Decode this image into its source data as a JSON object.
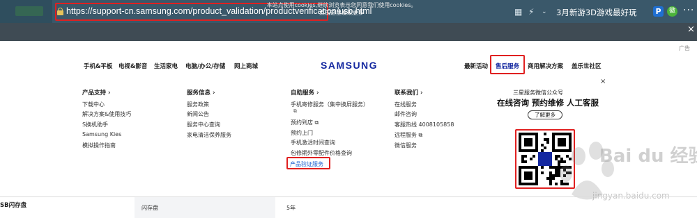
{
  "browser": {
    "url": "https://support-cn.samsung.com/product_validation/productverification/usb.html",
    "promo": "3月新游3D游戏最好玩",
    "avatar_p": "P",
    "avatar_g": "徽",
    "menu_dots": "···",
    "icons": [
      "grid-icon",
      "lightning-icon",
      "chevron-down-icon",
      "search-icon"
    ]
  },
  "cookie": {
    "text": "本站点使用cookies,继续浏览表示您同意我们使用cookies。",
    "link": "点击这里发现更多",
    "close": "×"
  },
  "ad_label": "广告",
  "nav": {
    "left": [
      "手机&平板",
      "电视&影音",
      "生活家电",
      "电脑/办公/存储",
      "网上商城"
    ],
    "logo": "SAMSUNG",
    "right": [
      "最新活动",
      "售后服务",
      "商用解决方案",
      "盖乐世社区"
    ],
    "active": "售后服务"
  },
  "columns": [
    {
      "head": "产品支持 ›",
      "items": [
        "下载中心",
        "解决方案&使用技巧",
        "S换机助手",
        "Samsung Kies",
        "模拟操作指南"
      ]
    },
    {
      "head": "服务信息 ›",
      "items": [
        "服务政策",
        "新闻公告",
        "服务中心查询",
        "家电清洁保养服务"
      ]
    },
    {
      "head": "自助服务 ›",
      "items": [
        "手机寄修服务（集中换屏服务）",
        "⧉",
        "预约到店 ⧉",
        "预约上门",
        "手机激活时间查询",
        "包修期外零配件价格查询",
        "产品验证服务"
      ]
    },
    {
      "head": "联系我们 ›",
      "items": [
        "在线服务",
        "邮件咨询",
        "客服热线 4008105858",
        "远程服务 ⧉",
        "微信服务"
      ]
    }
  ],
  "qr_panel": {
    "close": "×",
    "title": "三星服务微信公众号",
    "subtitle": "在线咨询 预约维修 人工客服",
    "button": "了解更多",
    "watermark": "Bai du 经验",
    "watermark_url": "jingyan.baidu.com"
  },
  "bottom": {
    "head": "SB闪存盘",
    "cell1": "闪存盘",
    "cell2": "5年"
  }
}
